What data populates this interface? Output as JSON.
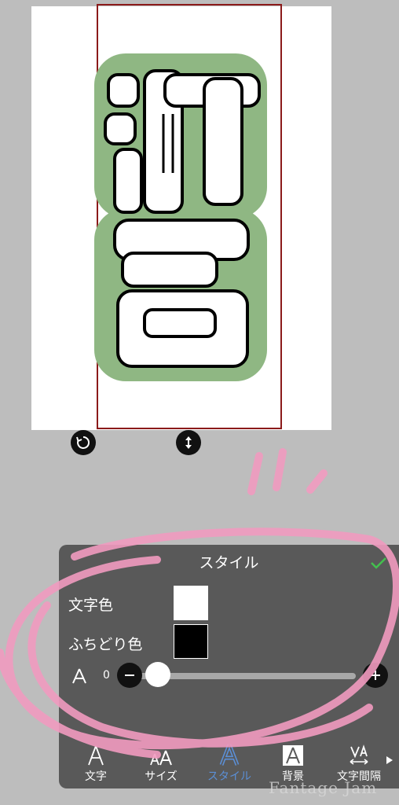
{
  "panel": {
    "title": "スタイル",
    "text_color_label": "文字色",
    "outline_color_label": "ふちどり色",
    "text_color": "#ffffff",
    "outline_color": "#000000",
    "outline_width_value": "0",
    "outline_width_level": 0
  },
  "tabs": [
    {
      "label": "文字",
      "icon": "letter-a-icon",
      "active": false
    },
    {
      "label": "サイズ",
      "icon": "text-size-icon",
      "active": false
    },
    {
      "label": "スタイル",
      "icon": "outlined-letter-icon",
      "active": true
    },
    {
      "label": "背景",
      "icon": "letter-background-icon",
      "active": false
    },
    {
      "label": "文字間隔",
      "icon": "letter-spacing-icon",
      "active": false
    }
  ],
  "canvas": {
    "characters": "河合",
    "fill_color": "#ffffff",
    "stroke_color": "#000000",
    "halo_color": "#8fb783"
  },
  "watermark": "Fantage Jam",
  "colors": {
    "background": "#bdbdbd",
    "panel": "#595959",
    "accent": "#5b8fd6",
    "confirm": "#43c04e",
    "marker": "#f19bc0"
  }
}
